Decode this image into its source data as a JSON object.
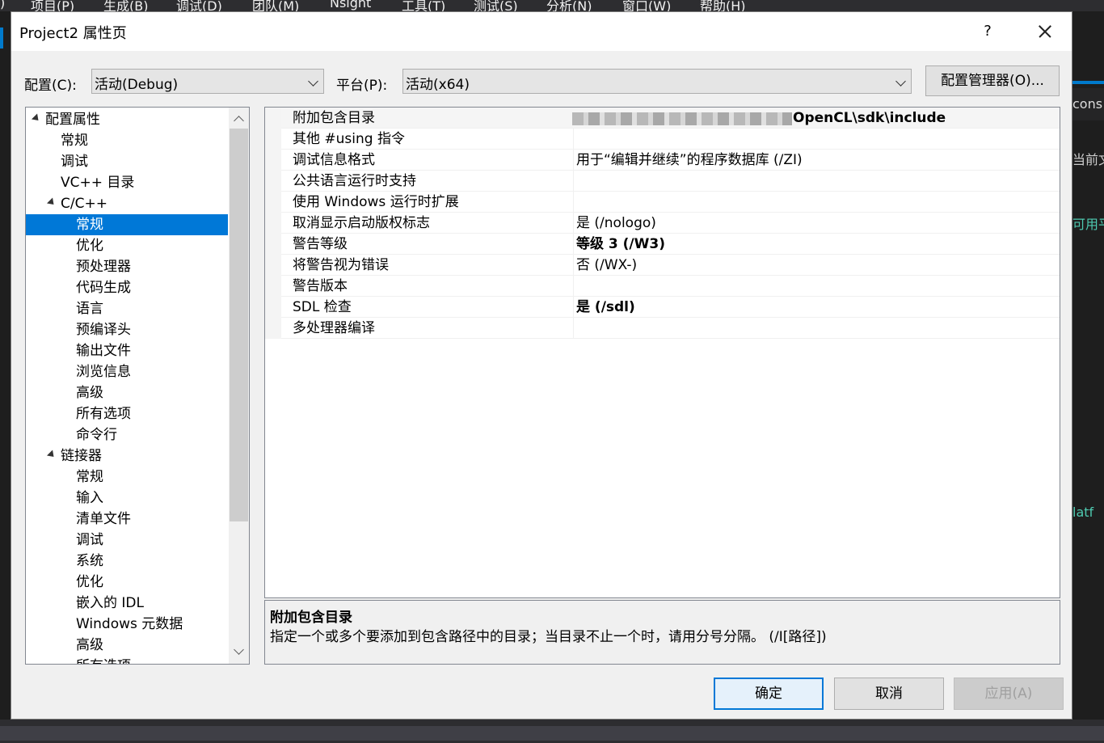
{
  "ide": {
    "menu": [
      "项目(P)",
      "生成(B)",
      "调试(D)",
      "团队(M)",
      "Nsight",
      "工具(T)",
      "测试(S)",
      "分析(N)",
      "窗口(W)",
      "帮助(H)"
    ],
    "right_text_1": "cons",
    "right_text_2": "当前文",
    "right_text_3": "可用平",
    "right_text_4": "latf"
  },
  "dialog": {
    "title": "Project2 属性页",
    "help_label": "?",
    "config_label": "配置(C):",
    "config_value": "活动(Debug)",
    "platform_label": "平台(P):",
    "platform_value": "活动(x64)",
    "config_manager_label": "配置管理器(O)...",
    "ok_label": "确定",
    "cancel_label": "取消",
    "apply_label": "应用(A)"
  },
  "tree": [
    {
      "label": "配置属性"
    },
    {
      "label": "常规"
    },
    {
      "label": "调试"
    },
    {
      "label": "VC++ 目录"
    },
    {
      "label": "C/C++"
    },
    {
      "label": "常规"
    },
    {
      "label": "优化"
    },
    {
      "label": "预处理器"
    },
    {
      "label": "代码生成"
    },
    {
      "label": "语言"
    },
    {
      "label": "预编译头"
    },
    {
      "label": "输出文件"
    },
    {
      "label": "浏览信息"
    },
    {
      "label": "高级"
    },
    {
      "label": "所有选项"
    },
    {
      "label": "命令行"
    },
    {
      "label": "链接器"
    },
    {
      "label": "常规"
    },
    {
      "label": "输入"
    },
    {
      "label": "清单文件"
    },
    {
      "label": "调试"
    },
    {
      "label": "系统"
    },
    {
      "label": "优化"
    },
    {
      "label": "嵌入的 IDL"
    },
    {
      "label": "Windows 元数据"
    },
    {
      "label": "高级"
    },
    {
      "label": "所有选项"
    }
  ],
  "grid": [
    {
      "name": "附加包含目录",
      "value": "OpenCL\\sdk\\include"
    },
    {
      "name": "其他 #using 指令",
      "value": ""
    },
    {
      "name": "调试信息格式",
      "value": "用于“编辑并继续”的程序数据库 (/ZI)"
    },
    {
      "name": "公共语言运行时支持",
      "value": ""
    },
    {
      "name": "使用 Windows 运行时扩展",
      "value": ""
    },
    {
      "name": "取消显示启动版权标志",
      "value": "是 (/nologo)"
    },
    {
      "name": "警告等级",
      "value": "等级 3 (/W3)"
    },
    {
      "name": "将警告视为错误",
      "value": "否 (/WX-)"
    },
    {
      "name": "警告版本",
      "value": ""
    },
    {
      "name": "SDL 检查",
      "value": "是 (/sdl)"
    },
    {
      "name": "多处理器编译",
      "value": ""
    }
  ],
  "description": {
    "title": "附加包含目录",
    "body": "指定一个或多个要添加到包含路径中的目录；当目录不止一个时，请用分号分隔。      (/I[路径])"
  }
}
